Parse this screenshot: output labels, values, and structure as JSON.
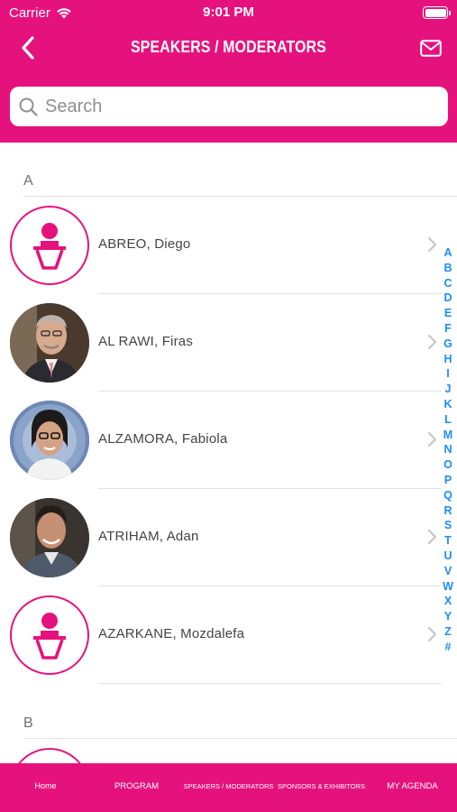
{
  "status_bar": {
    "carrier": "Carrier",
    "time": "9:01 PM"
  },
  "nav": {
    "title": "SPEAKERS / MODERATORS"
  },
  "search": {
    "placeholder": "Search"
  },
  "sections": [
    {
      "letter": "A",
      "speakers": [
        {
          "name": "ABREO, Diego",
          "avatar": "speaker-placeholder-icon"
        },
        {
          "name": "AL RAWI, Firas",
          "avatar": "photo"
        },
        {
          "name": "ALZAMORA, Fabiola",
          "avatar": "photo"
        },
        {
          "name": "ATRIHAM, Adan",
          "avatar": "photo"
        },
        {
          "name": "AZARKANE, Mozdalefa",
          "avatar": "speaker-placeholder-icon"
        }
      ]
    },
    {
      "letter": "B",
      "speakers": []
    }
  ],
  "index": [
    "A",
    "B",
    "C",
    "D",
    "E",
    "F",
    "G",
    "H",
    "I",
    "J",
    "K",
    "L",
    "M",
    "N",
    "O",
    "P",
    "Q",
    "R",
    "S",
    "T",
    "U",
    "V",
    "W",
    "X",
    "Y",
    "Z",
    "#"
  ],
  "tabs": [
    "Home",
    "PROGRAM",
    "SPEAKERS / MODERATORS",
    "SPONSORS & EXHIBITORS",
    "MY AGENDA"
  ],
  "colors": {
    "brand": "#e5127d",
    "index": "#1a8cff"
  }
}
